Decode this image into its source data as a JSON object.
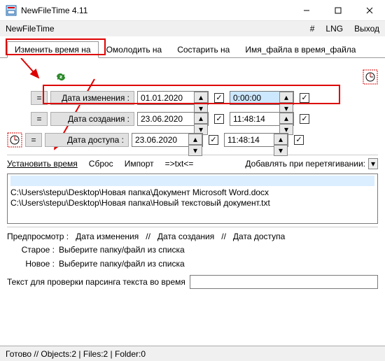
{
  "window": {
    "title": "NewFileTime 4.11",
    "app_name": "NewFileTime"
  },
  "menubar": {
    "hash": "#",
    "lng": "LNG",
    "exit": "Выход"
  },
  "tabs": {
    "change": "Изменить время на",
    "younger": "Омолодить на",
    "older": "Состарить на",
    "filename": "Имя_файла в время_файла"
  },
  "rows": {
    "eq": "=",
    "modified": {
      "label": "Дата изменения :",
      "date": "01.01.2020",
      "time": "0:00:00"
    },
    "created": {
      "label": "Дата создания :",
      "date": "23.06.2020",
      "time": "11:48:14"
    },
    "accessed": {
      "label": "Дата доступа :",
      "date": "23.06.2020",
      "time": "11:48:14"
    }
  },
  "actions": {
    "set_time": "Установить время",
    "reset": "Сброс",
    "import": "Импорт",
    "txteq": "=>txt<=",
    "add_on_drag": "Добавлять при перетягивании:"
  },
  "files": {
    "f1": "C:\\Users\\stepu\\Desktop\\Новая папка\\Документ Microsoft Word.docx",
    "f2": "C:\\Users\\stepu\\Desktop\\Новая папка\\Новый текстовый документ.txt"
  },
  "preview": {
    "header_preview": "Предпросмотр :",
    "header_mod": "Дата изменения",
    "header_cre": "Дата создания",
    "header_acc": "Дата доступа",
    "sep": "//",
    "old_label": "Старое :",
    "new_label": "Новое :",
    "pick_text": "Выберите папку/файл из списка"
  },
  "parse": {
    "label": "Текст для проверки парсинга текста во время"
  },
  "status": {
    "text": "Готово // Objects:2 | Files:2 | Folder:0"
  },
  "icons": {
    "spin_up": "▴",
    "spin_dn": "▾",
    "dd": "▾"
  }
}
